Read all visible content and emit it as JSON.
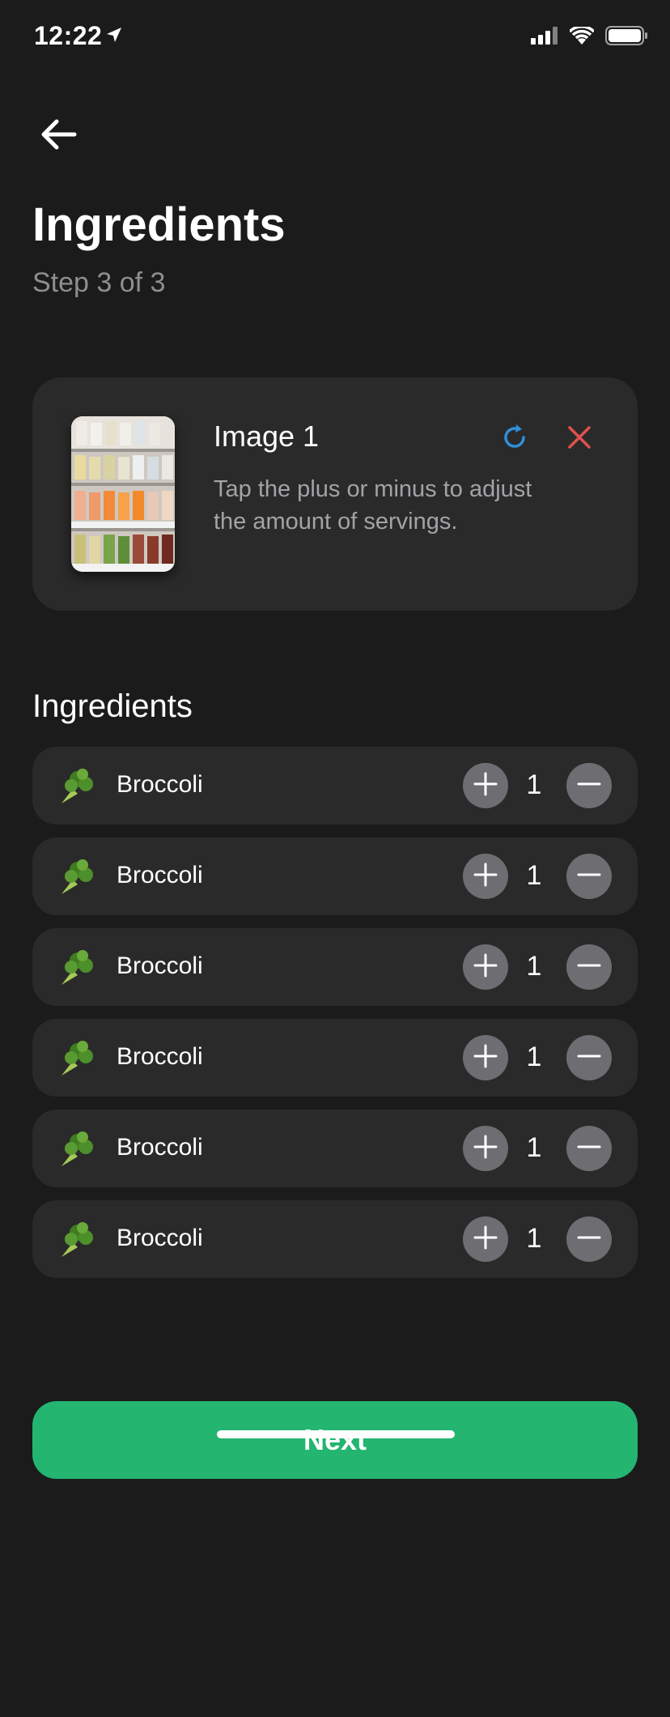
{
  "status_bar": {
    "time": "12:22"
  },
  "header": {
    "title": "Ingredients",
    "subtitle": "Step 3 of 3"
  },
  "image_card": {
    "title": "Image 1",
    "description": "Tap the plus or minus to adjust the amount of servings."
  },
  "ingredients_section": {
    "title": "Ingredients",
    "items": [
      {
        "icon": "broccoli-icon",
        "name": "Broccoli",
        "quantity": "1"
      },
      {
        "icon": "broccoli-icon",
        "name": "Broccoli",
        "quantity": "1"
      },
      {
        "icon": "broccoli-icon",
        "name": "Broccoli",
        "quantity": "1"
      },
      {
        "icon": "broccoli-icon",
        "name": "Broccoli",
        "quantity": "1"
      },
      {
        "icon": "broccoli-icon",
        "name": "Broccoli",
        "quantity": "1"
      },
      {
        "icon": "broccoli-icon",
        "name": "Broccoli",
        "quantity": "1"
      }
    ]
  },
  "actions": {
    "next_label": "Next"
  },
  "colors": {
    "background": "#1b1b1b",
    "card": "#2a2a2a",
    "accent_green": "#24b571",
    "refresh_blue": "#2f8fd8",
    "remove_red": "#e0524f",
    "stepper_gray": "#6d6d72"
  }
}
